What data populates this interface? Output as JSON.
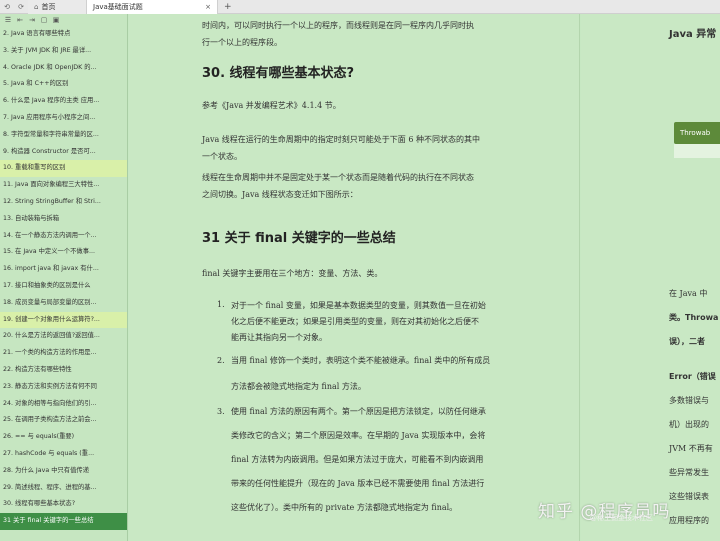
{
  "titlebar": {
    "back_icon": "back-arrow",
    "forward_icon": "forward-arrow",
    "home_tab": "首页",
    "active_tab": "Java基础面试题",
    "close": "×",
    "new_tab": "+"
  },
  "sidebar": {
    "tools": [
      "☰",
      "⇤",
      "⇥",
      "▢",
      "▣"
    ],
    "items": [
      "2. Java 语言有哪些特点",
      "3. 关于 JVM JDK 和 JRE 最详...",
      "4. Oracle JDK 和 OpenJDK 的...",
      "5. Java 和 C++的区别",
      "6. 什么是 Java 程序的主类 应用...",
      "7. Java 应用程序与小程序之间...",
      "8. 字符型常量和字符串常量的区...",
      "9. 构造器 Constructor 是否可...",
      "10. 重载和重写的区别",
      "11. Java 面向对象编程三大特性...",
      "12. String StringBuffer 和 Stri...",
      "13. 自动装箱与拆箱",
      "14. 在一个静态方法内调用一个...",
      "15. 在 Java 中定义一个不做事...",
      "16. import java 和 javax 有什...",
      "17. 接口和抽象类的区别是什么",
      "18. 成员变量与局部变量的区别...",
      "19. 创建一个对象用什么运算符?...",
      "20. 什么是方法的返回值?返回值...",
      "21. 一个类的构造方法的作用是...",
      "22. 构造方法有哪些特性",
      "23. 静态方法和实例方法有何不同",
      "24. 对象的相等与指向他们的引...",
      "25. 在调用子类构造方法之前会...",
      "26. == 与 equals(重要)",
      "27. hashCode 与 equals (重...",
      "28. 为什么 Java 中只有值传递",
      "29. 简述线程、程序、进程的基...",
      "30. 线程有哪些基本状态?",
      "31 关于 final 关键字的一些总结"
    ]
  },
  "content": {
    "intro_line1": "时间内，可以同时执行一个以上的程序，而线程则是在同一程序内几乎同时执",
    "intro_line2": "行一个以上的程序段。",
    "h30": "30. 线程有哪些基本状态?",
    "ref": "参考《Java 并发编程艺术》4.1.4 节。",
    "p1_line1": "Java 线程在运行的生命周期中的指定时刻只可能处于下面 6 种不同状态的其中",
    "p1_line2": "一个状态。",
    "p2_line1": "线程在生命周期中并不是固定处于某一个状态而是随着代码的执行在不同状态",
    "p2_line2": "之间切换。Java 线程状态变迁如下图所示：",
    "h31": "31 关于 final 关键字的一些总结",
    "intro31": "final 关键字主要用在三个地方：变量、方法、类。",
    "items": [
      {
        "num": "1.",
        "lines": [
          "对于一个 final 变量，如果是基本数据类型的变量，则其数值一旦在初始",
          "化之后便不能更改；如果是引用类型的变量，则在对其初始化之后便不",
          "能再让其指向另一个对象。"
        ]
      },
      {
        "num": "2.",
        "lines": [
          "当用 final 修饰一个类时，表明这个类不能被继承。final 类中的所有成员",
          "方法都会被隐式地指定为 final 方法。"
        ]
      },
      {
        "num": "3.",
        "lines": [
          "使用 final 方法的原因有两个。第一个原因是把方法锁定，以防任何继承",
          "类修改它的含义；第二个原因是效率。在早期的 Java 实现版本中，会将",
          "final 方法转为内嵌调用。但是如果方法过于庞大，可能看不到内嵌调用",
          "带来的任何性能提升（现在的 Java 版本已经不需要使用 final 方法进行",
          "这些优化了）。类中所有的 private 方法都隐式地指定为 final。"
        ]
      }
    ]
  },
  "right": {
    "title": "Java 异常",
    "button": "Throwab",
    "lines": [
      "在 Java 中",
      "类。Throwa",
      "误），二者",
      "Error（错误",
      "多数错误与",
      "机）出现的",
      "JVM 不再有",
      "些异常发生",
      "这些错误表",
      "应用程序的"
    ]
  },
  "watermark": {
    "main": "知乎 @程序员吗",
    "sub": "@稀土掘金技术社区"
  },
  "colors": {
    "page_bg": "#c9e8c4",
    "selected_item": "#3e8f46",
    "highlight_item": "#d9f0a9",
    "button": "#5d8a3a"
  }
}
